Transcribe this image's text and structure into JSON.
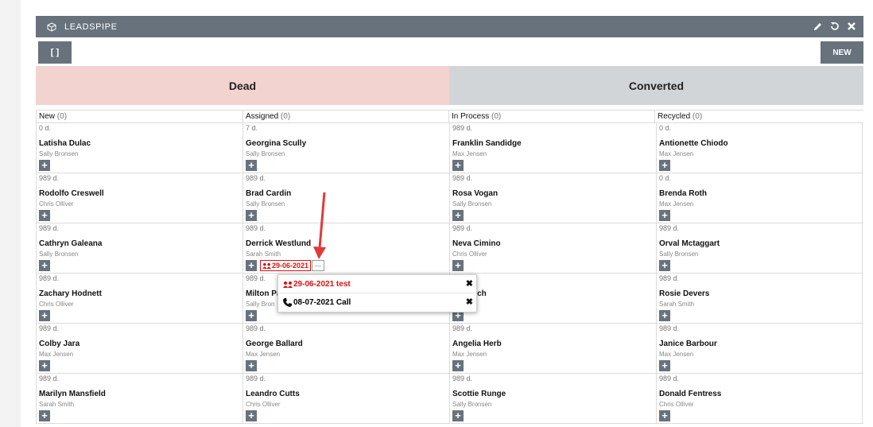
{
  "dashlet": {
    "title": "LEADSPIPE",
    "toggle_label": "[ ]",
    "new_label": "NEW"
  },
  "dropzones": {
    "dead": "Dead",
    "converted": "Converted"
  },
  "columns": [
    {
      "label": "New",
      "count": "(0)"
    },
    {
      "label": "Assigned",
      "count": "(0)"
    },
    {
      "label": "In Process",
      "count": "(0)"
    },
    {
      "label": "Recycled",
      "count": "(0)"
    }
  ],
  "rows": [
    [
      {
        "age": "0 d.",
        "name": "Latisha Dulac",
        "user": "Sally Bronsen"
      },
      {
        "age": "7 d.",
        "name": "Georgina Scully",
        "user": "Sally Bronsen"
      },
      {
        "age": "989 d.",
        "name": "Franklin Sandidge",
        "user": "Max Jensen"
      },
      {
        "age": "0 d.",
        "name": "Antionette Chiodo",
        "user": "Max Jensen"
      }
    ],
    [
      {
        "age": "989 d.",
        "name": "Rodolfo Creswell",
        "user": "Chris Olliver"
      },
      {
        "age": "989 d.",
        "name": "Brad Cardin",
        "user": "Sally Bronsen"
      },
      {
        "age": "989 d.",
        "name": "Rosa Vogan",
        "user": "Sally Bronsen"
      },
      {
        "age": "0 d.",
        "name": "Brenda Roth",
        "user": "Max Jensen"
      }
    ],
    [
      {
        "age": "989 d.",
        "name": "Cathryn Galeana",
        "user": "Sally Bronsen"
      },
      {
        "age": "989 d.",
        "name": "Derrick Westlund",
        "user": "Sarah Smith"
      },
      {
        "age": "989 d.",
        "name": "Neva Cimino",
        "user": "Chris Olliver"
      },
      {
        "age": "989 d.",
        "name": "Orval Mctaggart",
        "user": "Sally Bronsen"
      }
    ],
    [
      {
        "age": "989 d.",
        "name": "Zachary Hodnett",
        "user": "Chris Olliver"
      },
      {
        "age": "989 d.",
        "name": "Milton Pa",
        "user": "Sally Bron"
      },
      {
        "age": "989 d.",
        "name": "n Emrich",
        "user": "sen"
      },
      {
        "age": "989 d.",
        "name": "Rosie Devers",
        "user": "Sarah Smith"
      }
    ],
    [
      {
        "age": "989 d.",
        "name": "Colby Jara",
        "user": "Max Jensen"
      },
      {
        "age": "989 d.",
        "name": "George Ballard",
        "user": "Max Jensen"
      },
      {
        "age": "989 d.",
        "name": "Angelia Herb",
        "user": "Max Jensen"
      },
      {
        "age": "989 d.",
        "name": "Janice Barbour",
        "user": "Max Jensen"
      }
    ],
    [
      {
        "age": "989 d.",
        "name": "Marilyn Mansfield",
        "user": "Sarah Smith"
      },
      {
        "age": "989 d.",
        "name": "Leandro Cutts",
        "user": "Chris Olliver"
      },
      {
        "age": "989 d.",
        "name": "Scottie Runge",
        "user": "Sally Bronsen"
      },
      {
        "age": "989 d.",
        "name": "Donald Fentress",
        "user": "Chris Olliver"
      }
    ]
  ],
  "activity_tag": {
    "date": "29-06-2021",
    "more": "..."
  },
  "popup": {
    "items": [
      {
        "text": "29-06-2021 test",
        "icon": "meeting-icon"
      },
      {
        "text": "08-07-2021 Call",
        "icon": "phone-icon"
      }
    ]
  },
  "colors": {
    "header": "#67727c",
    "dead": "#f3d3cf",
    "converted": "#d2d5d8",
    "meeting": "#dd1111",
    "arrow": "#e03a3a"
  }
}
